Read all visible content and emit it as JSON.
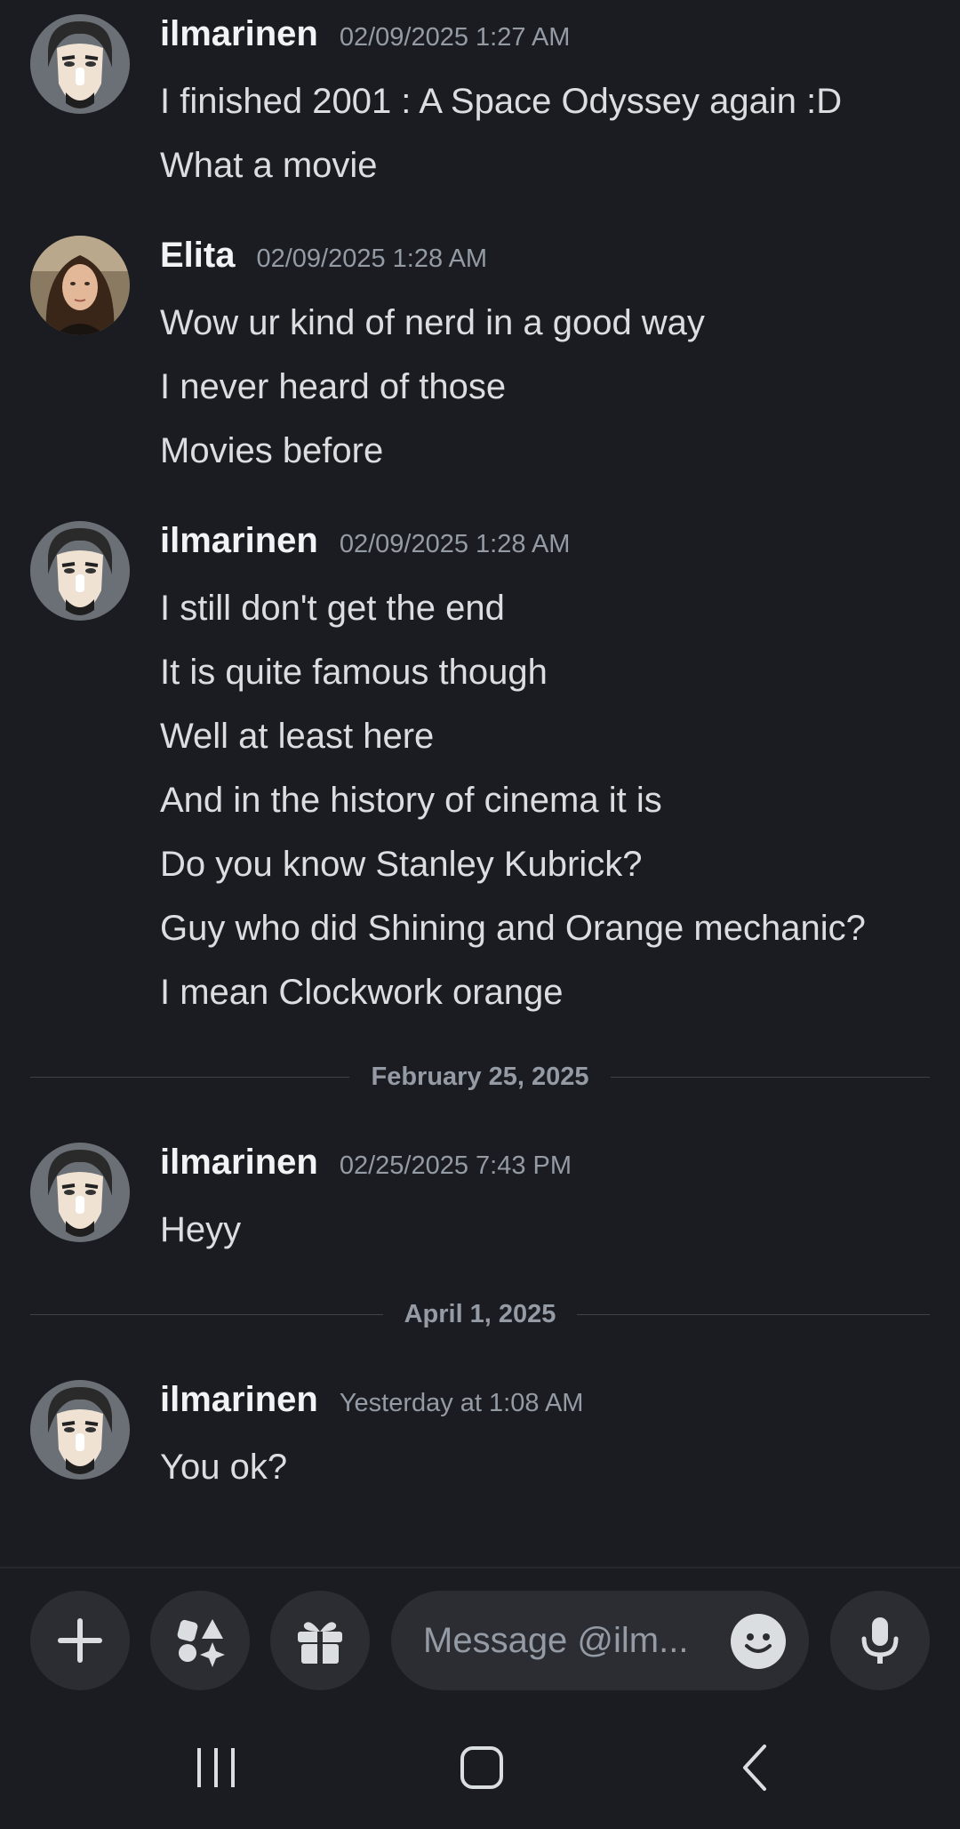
{
  "messages": [
    {
      "author": "ilmarinen",
      "timestamp": "02/09/2025 1:27 AM",
      "lines": [
        "I finished 2001 : A Space Odyssey again :D",
        "What a movie"
      ]
    },
    {
      "author": "Elita",
      "timestamp": "02/09/2025 1:28 AM",
      "lines": [
        "Wow ur kind of nerd in a good way",
        "I never heard of those",
        "Movies before"
      ]
    },
    {
      "author": "ilmarinen",
      "timestamp": "02/09/2025 1:28 AM",
      "lines": [
        "I still don't get the end",
        "It is quite famous though",
        "Well at least here",
        "And in the history of cinema it is",
        "Do you know Stanley Kubrick?",
        "Guy who did Shining and Orange mechanic?",
        "I mean Clockwork orange"
      ]
    },
    {
      "author": "ilmarinen",
      "timestamp": "02/25/2025 7:43 PM",
      "lines": [
        "Heyy"
      ]
    },
    {
      "author": "ilmarinen",
      "timestamp": "Yesterday at 1:08 AM",
      "lines": [
        "You ok?"
      ]
    }
  ],
  "dividers": [
    "February 25, 2025",
    "April 1, 2025"
  ],
  "composer": {
    "placeholder": "Message @ilm...",
    "plus_icon": "plus-icon",
    "apps_icon": "apps-icon",
    "gift_icon": "gift-icon",
    "emoji_icon": "emoji-icon",
    "mic_icon": "microphone-icon"
  },
  "colors": {
    "background": "#1b1c21",
    "button_bg": "#2b2d33",
    "username": "#f2f3f5",
    "timestamp": "#949ba4",
    "text": "#dbdee1"
  }
}
